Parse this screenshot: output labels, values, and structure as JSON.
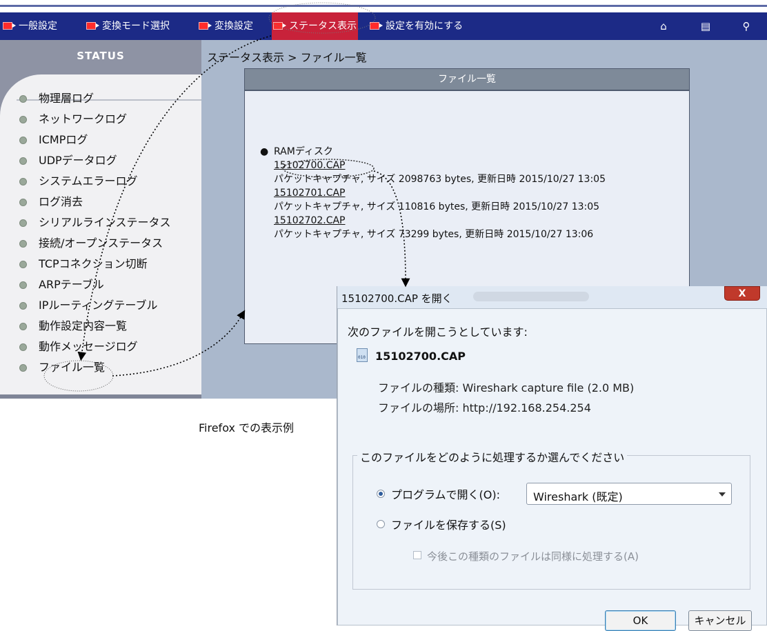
{
  "nav": {
    "items": [
      {
        "label": "一般設定"
      },
      {
        "label": "変換モード選択"
      },
      {
        "label": "変換設定"
      },
      {
        "label": "ステータス表示"
      },
      {
        "label": "設定を有効にする"
      }
    ],
    "icons": [
      "home-icon",
      "document-icon",
      "search-icon"
    ]
  },
  "sidebar": {
    "title": "STATUS",
    "items": [
      {
        "label": "物理層ログ"
      },
      {
        "label": "ネットワークログ"
      },
      {
        "label": "ICMPログ"
      },
      {
        "label": "UDPデータログ"
      },
      {
        "label": "システムエラーログ"
      },
      {
        "label": "ログ消去"
      },
      {
        "label": "シリアルラインステータス"
      },
      {
        "label": "接続/オープンステータス"
      },
      {
        "label": "TCPコネクション切断"
      },
      {
        "label": "ARPテーブル"
      },
      {
        "label": "IPルーティングテーブル"
      },
      {
        "label": "動作設定内容一覧"
      },
      {
        "label": "動作メッセージログ"
      },
      {
        "label": "ファイル一覧"
      }
    ]
  },
  "content": {
    "breadcrumb": "ステータス表示 > ファイル一覧",
    "panel_title": "ファイル一覧",
    "disk_label": "RAMディスク",
    "files": [
      {
        "name": "15102700.CAP",
        "desc": "パケットキャプチャ, サイズ 2098763 bytes, 更新日時 2015/10/27 13:05"
      },
      {
        "name": "15102701.CAP",
        "desc": "パケットキャプチャ, サイズ 110816 bytes, 更新日時 2015/10/27 13:05"
      },
      {
        "name": "15102702.CAP",
        "desc": "パケットキャプチャ, サイズ 73299 bytes, 更新日時 2015/10/27 13:06"
      }
    ]
  },
  "caption": "Firefox での表示例",
  "dialog": {
    "title": "15102700.CAP を開く",
    "close_label": "X",
    "intro": "次のファイルを開こうとしています:",
    "filename": "15102700.CAP",
    "type_row": "ファイルの種類: Wireshark capture file (2.0 MB)",
    "location_row": "ファイルの場所: http://192.168.254.254",
    "group_title": "このファイルをどのように処理するか選んでください",
    "open_with_label": "プログラムで開く(O):",
    "app_select_value": "Wireshark (既定)",
    "save_label": "ファイルを保存する(S)",
    "remember_label": "今後この種類のファイルは同様に処理する(A)",
    "ok_label": "OK",
    "cancel_label": "キャンセル"
  },
  "colors": {
    "nav_bg": "#1c2a86",
    "nav_active": "#c8223a",
    "sidebar_bg": "#8e93a4",
    "content_bg": "#aab8cc",
    "panel_header": "#7e8a99"
  }
}
